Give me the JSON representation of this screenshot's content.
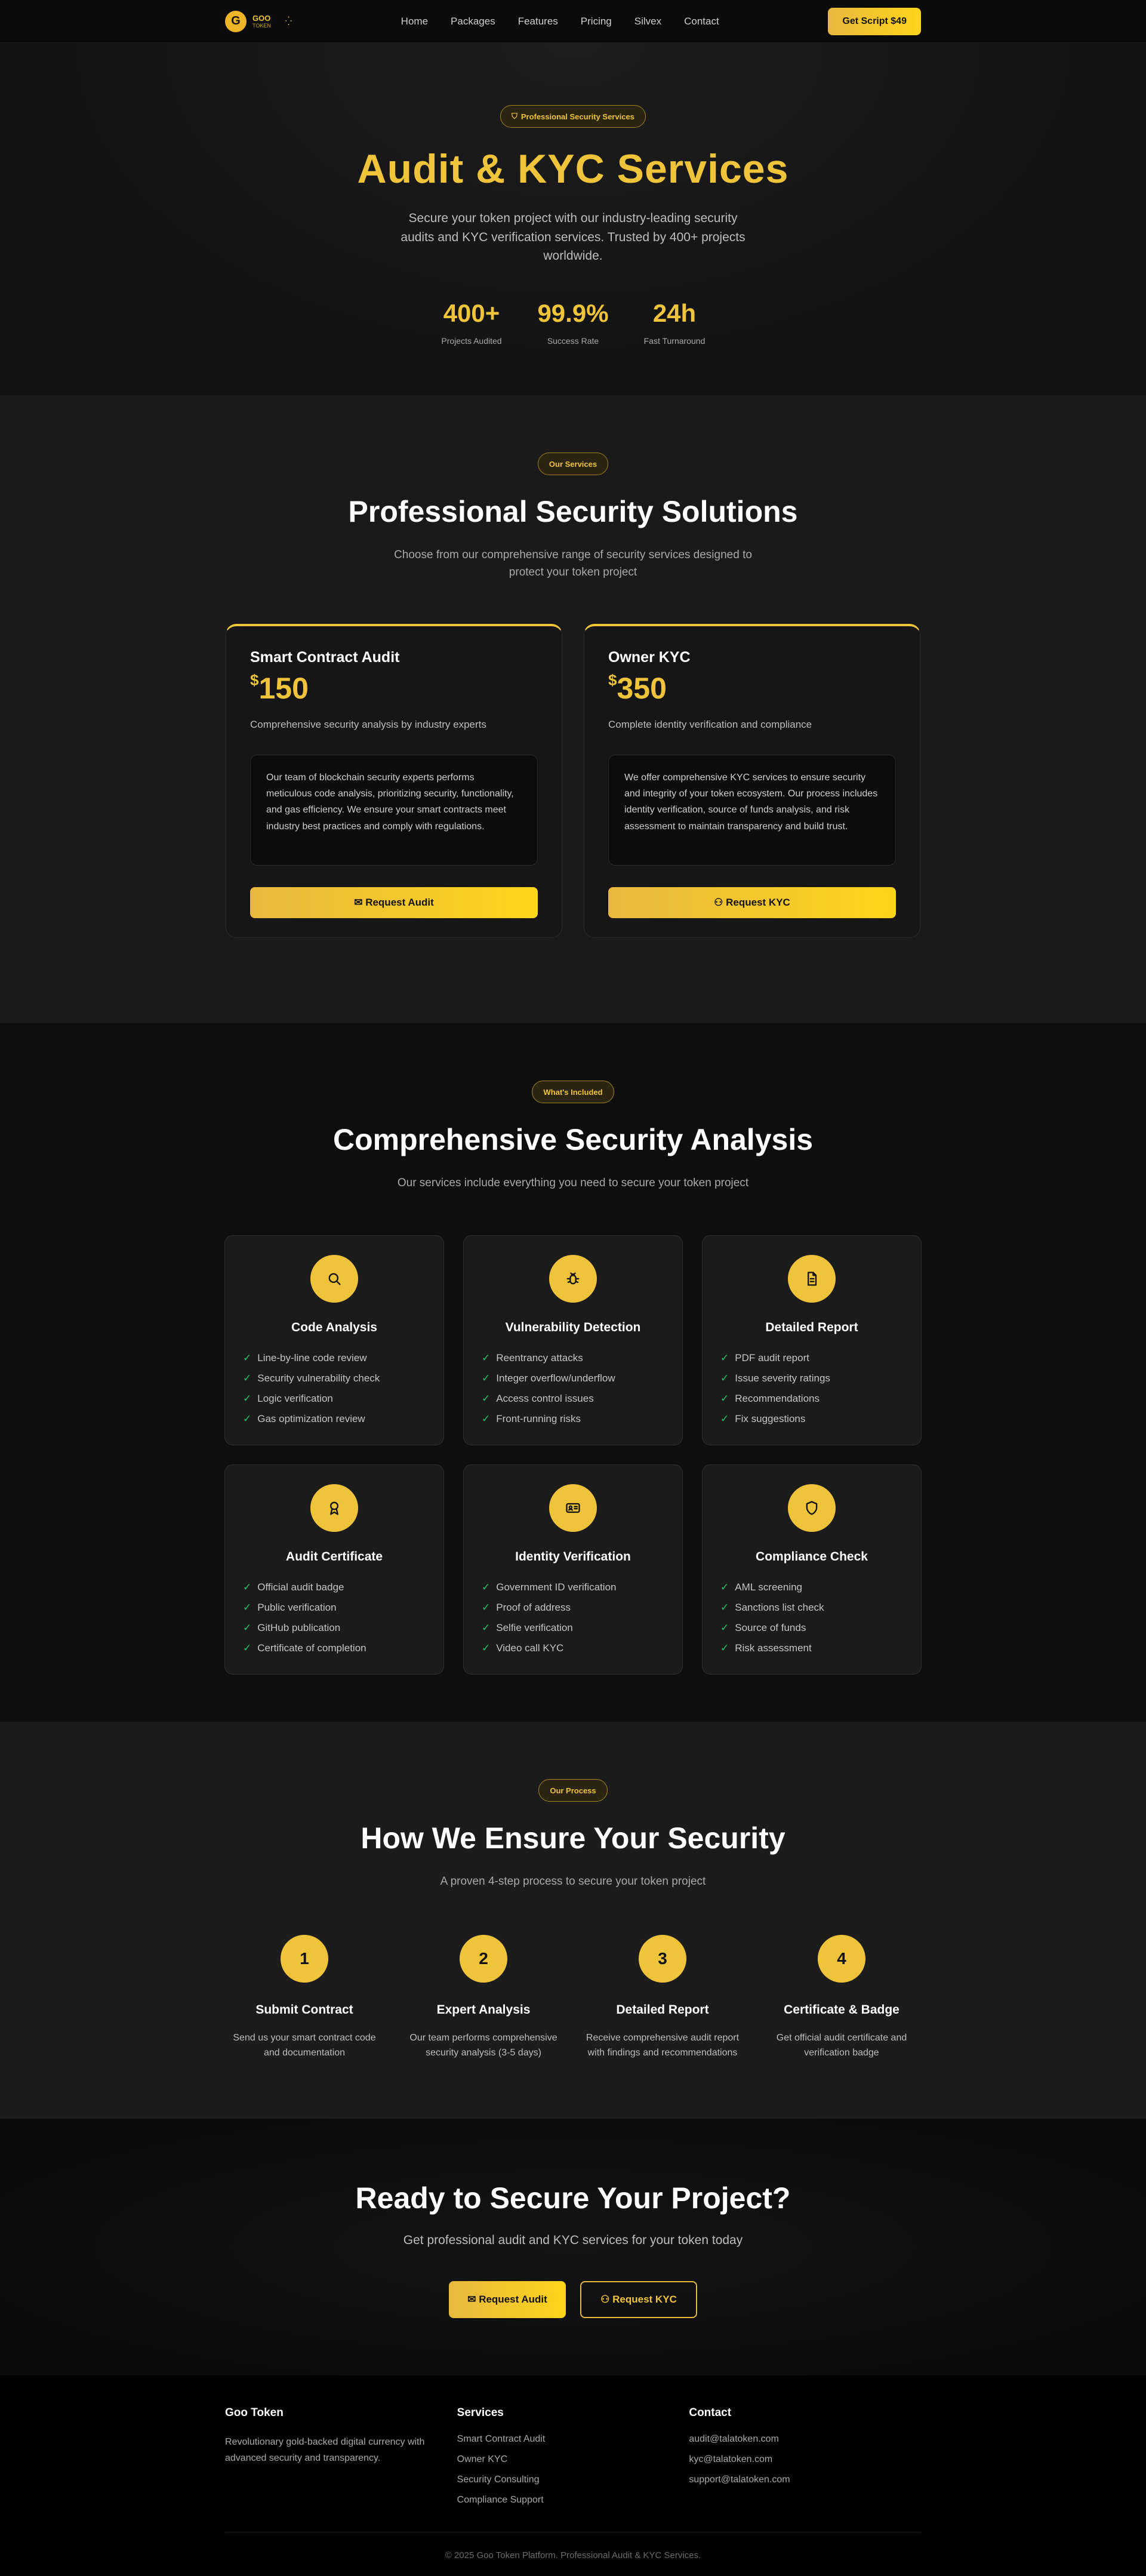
{
  "nav": {
    "logo_letter": "G",
    "logo_top": "GOO",
    "logo_bottom": "TOKEN",
    "links": [
      "Home",
      "Packages",
      "Features",
      "Pricing",
      "Silvex",
      "Contact"
    ],
    "cta": "Get Script $49"
  },
  "hero": {
    "badge": "Professional Security Services",
    "title": "Audit & KYC Services",
    "subtitle": "Secure your token project with our industry-leading security audits and KYC verification services. Trusted by 400+ projects worldwide.",
    "stats": [
      {
        "value": "400+",
        "label": "Projects Audited"
      },
      {
        "value": "99.9%",
        "label": "Success Rate"
      },
      {
        "value": "24h",
        "label": "Fast Turnaround"
      }
    ]
  },
  "services": {
    "badge": "Our Services",
    "title": "Professional Security Solutions",
    "subtitle": "Choose from our comprehensive range of security services designed to protect your token project",
    "cards": [
      {
        "title": "Smart Contract Audit",
        "currency": "$",
        "price": "150",
        "desc": "Comprehensive security analysis by industry experts",
        "body": "Our team of blockchain security experts performs meticulous code analysis, prioritizing security, functionality, and gas efficiency. We ensure your smart contracts meet industry best practices and comply with regulations.",
        "button": "Request Audit"
      },
      {
        "title": "Owner KYC",
        "currency": "$",
        "price": "350",
        "desc": "Complete identity verification and compliance",
        "body": "We offer comprehensive KYC services to ensure security and integrity of your token ecosystem. Our process includes identity verification, source of funds analysis, and risk assessment to maintain transparency and build trust.",
        "button": "Request KYC"
      }
    ]
  },
  "features": {
    "badge": "What's Included",
    "title": "Comprehensive Security Analysis",
    "subtitle": "Our services include everything you need to secure your token project",
    "check": "✓",
    "cards": [
      {
        "icon": "search-icon",
        "title": "Code Analysis",
        "items": [
          "Line-by-line code review",
          "Security vulnerability check",
          "Logic verification",
          "Gas optimization review"
        ]
      },
      {
        "icon": "bug-icon",
        "title": "Vulnerability Detection",
        "items": [
          "Reentrancy attacks",
          "Integer overflow/underflow",
          "Access control issues",
          "Front-running risks"
        ]
      },
      {
        "icon": "document-icon",
        "title": "Detailed Report",
        "items": [
          "PDF audit report",
          "Issue severity ratings",
          "Recommendations",
          "Fix suggestions"
        ]
      },
      {
        "icon": "award-icon",
        "title": "Audit Certificate",
        "items": [
          "Official audit badge",
          "Public verification",
          "GitHub publication",
          "Certificate of completion"
        ]
      },
      {
        "icon": "id-card-icon",
        "title": "Identity Verification",
        "items": [
          "Government ID verification",
          "Proof of address",
          "Selfie verification",
          "Video call KYC"
        ]
      },
      {
        "icon": "shield-icon",
        "title": "Compliance Check",
        "items": [
          "AML screening",
          "Sanctions list check",
          "Source of funds",
          "Risk assessment"
        ]
      }
    ]
  },
  "process": {
    "badge": "Our Process",
    "title": "How We Ensure Your Security",
    "subtitle": "A proven 4-step process to secure your token project",
    "steps": [
      {
        "num": "1",
        "title": "Submit Contract",
        "desc": "Send us your smart contract code and documentation"
      },
      {
        "num": "2",
        "title": "Expert Analysis",
        "desc": "Our team performs comprehensive security analysis (3-5 days)"
      },
      {
        "num": "3",
        "title": "Detailed Report",
        "desc": "Receive comprehensive audit report with findings and recommendations"
      },
      {
        "num": "4",
        "title": "Certificate & Badge",
        "desc": "Get official audit certificate and verification badge"
      }
    ]
  },
  "cta": {
    "title": "Ready to Secure Your Project?",
    "subtitle": "Get professional audit and KYC services for your token today",
    "audit_button": "Request Audit",
    "kyc_button": "Request KYC"
  },
  "footer": {
    "brand_title": "Goo Token",
    "brand_desc": "Revolutionary gold-backed digital currency with advanced security and transparency.",
    "services_title": "Services",
    "services_links": [
      "Smart Contract Audit",
      "Owner KYC",
      "Security Consulting",
      "Compliance Support"
    ],
    "contact_title": "Contact",
    "contact_links": [
      "audit@talatoken.com",
      "kyc@talatoken.com",
      "support@talatoken.com"
    ],
    "copyright": "© 2025 Goo Token Platform. Professional Audit & KYC Services."
  },
  "colors": {
    "accent": "#f0c43a",
    "check": "#22c55e",
    "background": "#0d0d0d"
  }
}
